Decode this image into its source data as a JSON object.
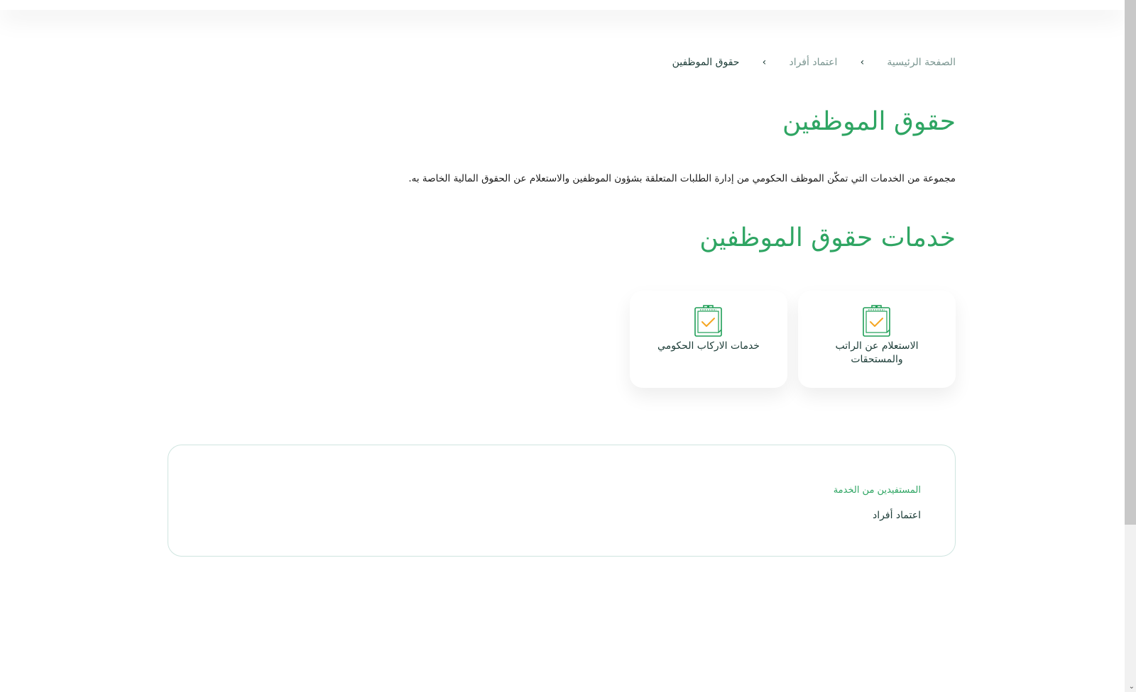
{
  "breadcrumb": {
    "home": "الصفحة الرئيسية",
    "parent": "اعتماد أفراد",
    "current": "حقوق الموظفين"
  },
  "page": {
    "title": "حقوق الموظفين",
    "description": "مجموعة من الخدمات التي تمكّن الموظف الحكومي من إدارة الطلبات المتعلقة بشؤون الموظفين والاستعلام عن الحقوق المالية الخاصة به."
  },
  "services": {
    "title": "خدمات حقوق الموظفين",
    "items": [
      {
        "label": "الاستعلام عن الراتب والمستحقات",
        "icon": "clipboard-check-icon"
      },
      {
        "label": "خدمات الاركاب الحكومي",
        "icon": "clipboard-check-icon"
      }
    ]
  },
  "beneficiaries": {
    "heading": "المستفيدين من الخدمة",
    "value": "اعتماد أفراد"
  },
  "colors": {
    "accent_green": "#2fa563",
    "text_dark": "#1b3b36",
    "icon_green": "#1e9e56",
    "icon_orange": "#f5a623"
  }
}
